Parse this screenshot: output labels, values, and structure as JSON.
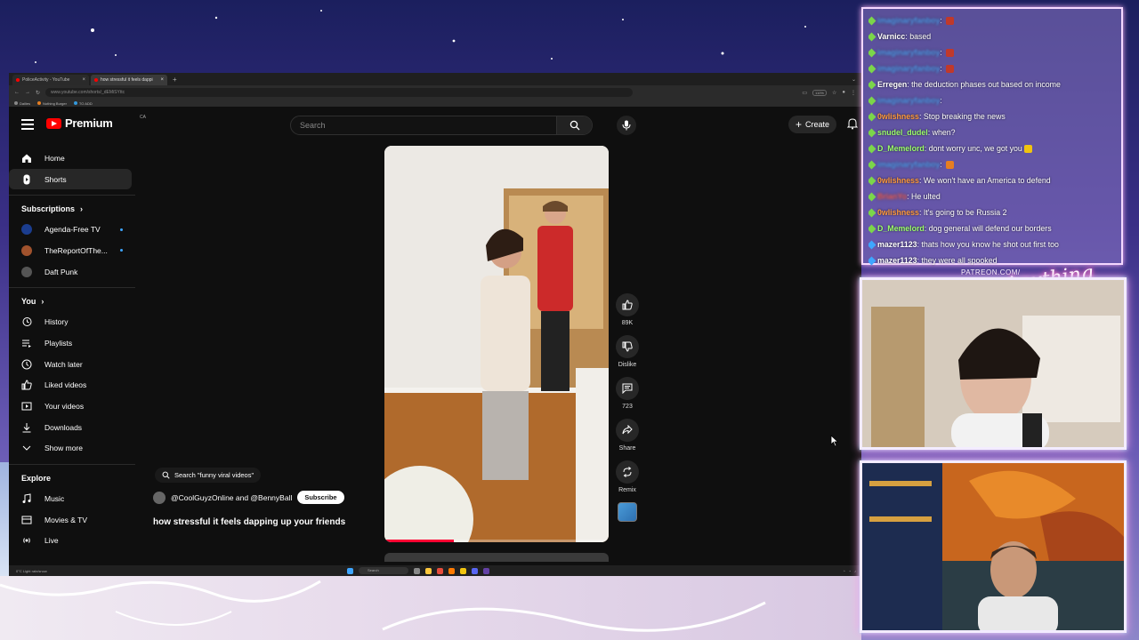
{
  "browser": {
    "tabs": [
      {
        "label": "PoliceActivity - YouTube",
        "active": false
      },
      {
        "label": "how stressful it feels dappi",
        "active": true
      }
    ],
    "url": "www.youtube.com/shorts/_dEMiSYttc",
    "zoom": "110%",
    "bookmarks": [
      "Dailies",
      "Nothing Burger",
      "TO ADD"
    ]
  },
  "youtube": {
    "logo_text": "Premium",
    "logo_region": "CA",
    "search_placeholder": "Search",
    "create_label": "Create",
    "nav": [
      {
        "label": "Home",
        "icon": "home-icon",
        "active": false
      },
      {
        "label": "Shorts",
        "icon": "shorts-icon",
        "active": true
      }
    ],
    "subscriptions_title": "Subscriptions",
    "subscriptions": [
      {
        "label": "Agenda-Free TV",
        "color": "#1b3d8f",
        "live": true
      },
      {
        "label": "TheReportOfThe...",
        "color": "#a0522d",
        "live": true
      },
      {
        "label": "Daft Punk",
        "color": "#555555",
        "live": false
      }
    ],
    "you_title": "You",
    "you_items": [
      {
        "label": "History",
        "icon": "history-icon"
      },
      {
        "label": "Playlists",
        "icon": "playlists-icon"
      },
      {
        "label": "Watch later",
        "icon": "watch-later-icon"
      },
      {
        "label": "Liked videos",
        "icon": "like-icon"
      },
      {
        "label": "Your videos",
        "icon": "your-videos-icon"
      },
      {
        "label": "Downloads",
        "icon": "download-icon"
      },
      {
        "label": "Show more",
        "icon": "chevron-down-icon"
      }
    ],
    "explore_title": "Explore",
    "explore_items": [
      {
        "label": "Music",
        "icon": "music-icon"
      },
      {
        "label": "Movies & TV",
        "icon": "movies-icon"
      },
      {
        "label": "Live",
        "icon": "live-icon"
      }
    ],
    "short": {
      "search_chip": "Search \"funny viral videos\"",
      "channel": "@CoolGuyzOnline and @BennyBall",
      "subscribe_label": "Subscribe",
      "title": "how stressful it feels dapping up your friends",
      "progress": 0.31,
      "actions": {
        "likes": "89K",
        "dislike": "Dislike",
        "comments": "723",
        "share": "Share",
        "remix": "Remix"
      }
    }
  },
  "taskbar": {
    "weather": "Light rain/snow",
    "weather_temp": "0°C",
    "search": "Search"
  },
  "chat": {
    "messages": [
      {
        "user": "imaginaryfanboy",
        "text": "",
        "color": "#59a8ff",
        "blurred": true,
        "emote": "#c0392b"
      },
      {
        "user": "Varnicc",
        "text": "based",
        "color": "#ffffff",
        "blurred": false
      },
      {
        "user": "imaginaryfanboy",
        "text": "",
        "color": "#59a8ff",
        "blurred": true,
        "emote": "#c0392b"
      },
      {
        "user": "imaginaryfanboy",
        "text": "",
        "color": "#59a8ff",
        "blurred": true,
        "emote": "#c0392b"
      },
      {
        "user": "Erregen",
        "text": "the deduction phases out based on income",
        "color": "#ffffff",
        "blurred": false
      },
      {
        "user": "imaginaryfanboy",
        "text": "",
        "color": "#59a8ff",
        "blurred": true
      },
      {
        "user": "0wlishness",
        "text": "Stop breaking the news",
        "color": "#ff9a3c",
        "blurred": false
      },
      {
        "user": "snudel_dudel",
        "text": "when?",
        "color": "#9cff6b",
        "blurred": false
      },
      {
        "user": "D_Memelord",
        "text": "dont worry unc, we got you",
        "color": "#9cff6b",
        "blurred": false,
        "emote": "#f1c40f"
      },
      {
        "user": "imaginaryfanboy",
        "text": "",
        "color": "#59a8ff",
        "blurred": true,
        "emote": "#e67e22"
      },
      {
        "user": "0wlishness",
        "text": "We won't have an America to defend",
        "color": "#ff9a3c",
        "blurred": false
      },
      {
        "user": "BrianYo",
        "text": "He ulted",
        "color": "#ff6b6b",
        "blurred": true
      },
      {
        "user": "0wlishness",
        "text": "It's going to be Russia 2",
        "color": "#ff9a3c",
        "blurred": false
      },
      {
        "user": "D_Memelord",
        "text": "dog general will defend our borders",
        "color": "#9cff6b",
        "blurred": false
      },
      {
        "user": "mazer1123",
        "text": "thats how you know he shot out first too",
        "color": "#ffffff",
        "blurred": false
      },
      {
        "user": "mazer1123",
        "text": "they were all spooked",
        "color": "#ffffff",
        "blurred": false
      }
    ]
  },
  "overlay": {
    "patreon": "PATREON.COM/",
    "brand": "Anything Else"
  }
}
